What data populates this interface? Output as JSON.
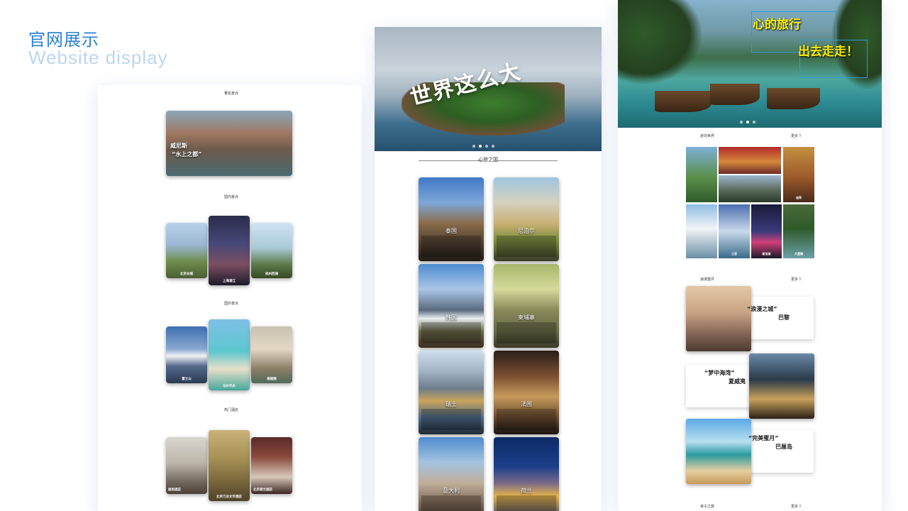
{
  "heading": {
    "cn": "官网展示",
    "en": "Website display"
  },
  "panel1": {
    "sec_famous": "著名景点",
    "venice": {
      "title": "威尼斯",
      "subtitle": "“水上之都”"
    },
    "sec_domestic": "国内景点",
    "domestic": [
      {
        "label": "北京长城"
      },
      {
        "label": "上海浦江"
      },
      {
        "label": "杭州西湖"
      }
    ],
    "sec_foreign": "国外景点",
    "foreign": [
      {
        "label": "富士山"
      },
      {
        "label": "马尔代夫"
      },
      {
        "label": "泰姬陵"
      }
    ],
    "sec_hotels": "热门酒店",
    "hotels": [
      {
        "label": "丽尚酒店"
      },
      {
        "label": "北京万达文华酒店"
      },
      {
        "label": "北京君兰酒店"
      }
    ]
  },
  "panel2": {
    "banner_text": "世界这么大",
    "section_title": "心旅之国",
    "countries": [
      {
        "name": "泰国"
      },
      {
        "name": "尼泊尔"
      },
      {
        "name": "韩国"
      },
      {
        "name": "柬埔寨"
      },
      {
        "name": "瑞士"
      },
      {
        "name": "法国"
      },
      {
        "name": "意大利"
      },
      {
        "name": "荷兰"
      }
    ]
  },
  "panel3": {
    "hero_line1": "心的旅行",
    "hero_line2": "出去走走！",
    "sec_world": "走向世界",
    "more": "更多 》",
    "tiles": [
      {
        "label": ""
      },
      {
        "label": ""
      },
      {
        "label": ""
      },
      {
        "label": "迪拜"
      },
      {
        "label": ""
      },
      {
        "label": "三亚"
      },
      {
        "label": "新加坡"
      },
      {
        "label": "大堡礁"
      }
    ],
    "sec_honeymoon": "浪漫蜜月",
    "features": [
      {
        "title": "“浪漫之城”",
        "sub": "巴黎"
      },
      {
        "title": "“梦中海湾”",
        "sub": "夏威夷"
      },
      {
        "title": "“完美蜜月”",
        "sub": "巴厘岛"
      }
    ],
    "sec_parent": "亲子之旅"
  }
}
